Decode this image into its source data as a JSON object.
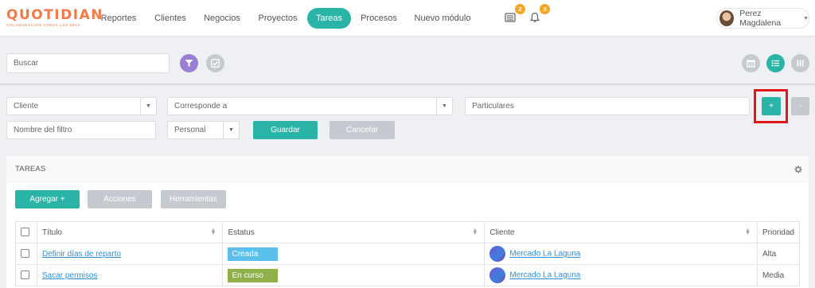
{
  "logo": {
    "main": "QUOTIDIAN",
    "tagline": "COLABORACIÓN TODOS LOS DÍAS"
  },
  "nav": {
    "items": [
      {
        "label": "Reportes"
      },
      {
        "label": "Clientes"
      },
      {
        "label": "Negocios"
      },
      {
        "label": "Proyectos"
      },
      {
        "label": "Tareas"
      },
      {
        "label": "Procesos"
      },
      {
        "label": "Nuevo módulo"
      }
    ],
    "active": "Tareas"
  },
  "header": {
    "inbox_badge": "2",
    "bell_badge": "3",
    "user_name": "Perez Magdalena"
  },
  "search": {
    "placeholder": "Buscar"
  },
  "filters": {
    "cliente": "Cliente",
    "corresponde": "Corresponde a",
    "particulares": "Particulares",
    "add_label": "+",
    "remove_label": "-",
    "filter_name_placeholder": "Nombre del filtro",
    "scope": "Personal",
    "save_label": "Guardar",
    "cancel_label": "Cancelar"
  },
  "panel": {
    "title": "TAREAS",
    "buttons": {
      "add": "Agregar +",
      "actions": "Acciones",
      "tools": "Herramientas"
    },
    "columns": [
      "Título",
      "Estatus",
      "Cliente",
      "Prioridad"
    ],
    "rows": [
      {
        "title": "Definir días de reparto",
        "status": "Creada",
        "status_color": "#5bc0eb",
        "client": "Mercado La Laguna",
        "priority": "Alta"
      },
      {
        "title": "Sacar permisos",
        "status": "En curso",
        "status_color": "#8fb04a",
        "client": "Mercado La Laguna",
        "priority": "Media"
      }
    ]
  },
  "colors": {
    "accent": "#2ab3a7",
    "filter_purple": "#9b7fd4",
    "highlight": "#e01a1a"
  }
}
